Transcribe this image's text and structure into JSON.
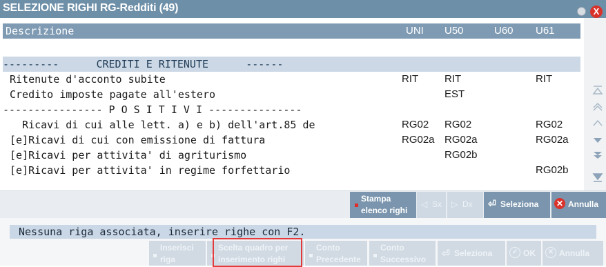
{
  "window": {
    "title": "SELEZIONE RIGHI  RG-Redditi (49)",
    "close_glyph": "X"
  },
  "header": {
    "descrizione": "Descrizione",
    "uni": "UNI",
    "u50": "U50",
    "u60": "U60",
    "u61": "U61"
  },
  "rows": [
    {
      "desc": "---------      CREDITI E RITENUTE      ------",
      "uni": "",
      "u50": "",
      "u60": "",
      "u61": ""
    },
    {
      "desc": "Ritenute d'acconto subite",
      "uni": "RIT",
      "u50": "RIT",
      "u60": "",
      "u61": "RIT"
    },
    {
      "desc": "Credito imposte pagate all'estero",
      "uni": "",
      "u50": "EST",
      "u60": "",
      "u61": ""
    },
    {
      "desc": "---------------- P O S I T I V I ---------------",
      "uni": "",
      "u50": "",
      "u60": "",
      "u61": ""
    },
    {
      "desc": "  Ricavi di cui alle lett. a) e b) dell'art.85 de",
      "uni": "RG02",
      "u50": "RG02",
      "u60": "",
      "u61": "RG02"
    },
    {
      "desc": "[e]Ricavi di cui con emissione di fattura",
      "uni": "RG02a",
      "u50": "RG02a",
      "u60": "",
      "u61": "RG02a"
    },
    {
      "desc": "[e]Ricavi per attivita' di agriturismo",
      "uni": "",
      "u50": "RG02b",
      "u60": "",
      "u61": ""
    },
    {
      "desc": "[e]Ricavi per attivita' in regime forfettario",
      "uni": "",
      "u50": "",
      "u60": "",
      "u61": "RG02b"
    }
  ],
  "toolbar": {
    "stampa_line1": "Stampa",
    "stampa_line2": "elenco righi",
    "sx": "Sx",
    "dx": "Dx",
    "seleziona": "Seleziona",
    "annulla": "Annulla"
  },
  "bottom": {
    "message": "Nessuna riga associata, inserire righe con F2.",
    "inserisci_1": "Inserisci",
    "inserisci_2": "riga",
    "scelta_1": "Scelta quadro per",
    "scelta_2": "inserimento righi",
    "conto_prec_1": "Conto",
    "conto_prec_2": "Precedente",
    "conto_succ_1": "Conto",
    "conto_succ_2": "Successivo",
    "seleziona": "Seleziona",
    "ok": "OK",
    "annulla": "Annulla"
  },
  "colors": {
    "title_bar": "#6d8fa8",
    "header": "#7f9bb3",
    "section_highlight": "#ccd8e6",
    "button_active": "#7a95ad",
    "button_disabled": "#d1dae3",
    "close_red": "#d9322b",
    "focus_outline": "#e53a3a"
  }
}
